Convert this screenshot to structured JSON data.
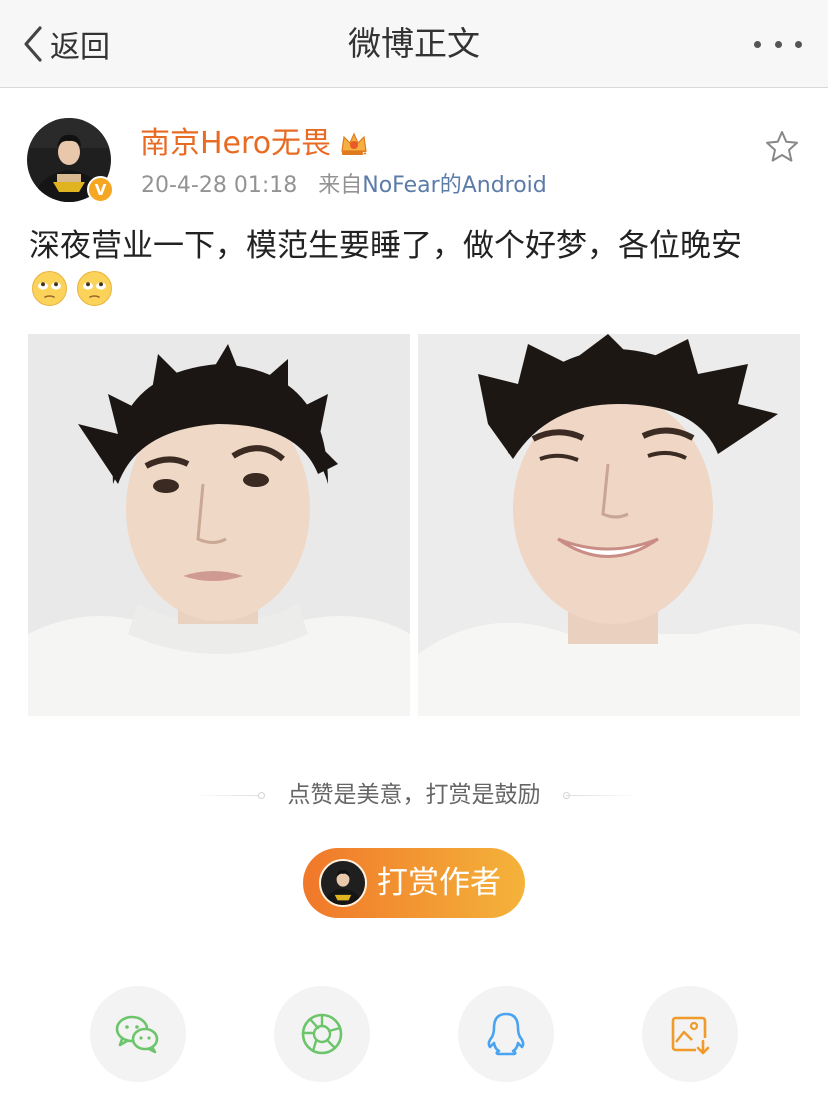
{
  "navbar": {
    "back_label": "返回",
    "title": "微博正文"
  },
  "post": {
    "username": "南京Hero无畏",
    "timestamp": "20-4-28 01:18",
    "source_prefix": "来自",
    "source_name": "NoFear的Android",
    "text": "深夜营业一下，模范生要睡了，做个好梦，各位晚安",
    "emojis": [
      "rolling-eyes-emoji",
      "rolling-eyes-emoji"
    ]
  },
  "reward": {
    "tip": "点赞是美意，打赏是鼓励",
    "button_label": "打赏作者"
  },
  "share_targets": [
    "wechat-icon",
    "wechat-moments-icon",
    "qq-icon",
    "save-image-icon"
  ],
  "colors": {
    "username": "#e86b24",
    "link": "#5b7ba9",
    "reward_start": "#f0782a",
    "reward_end": "#f4b33a",
    "share_green": "#6cc56a",
    "share_blue": "#4aa3f0",
    "share_orange": "#f09a2a"
  }
}
